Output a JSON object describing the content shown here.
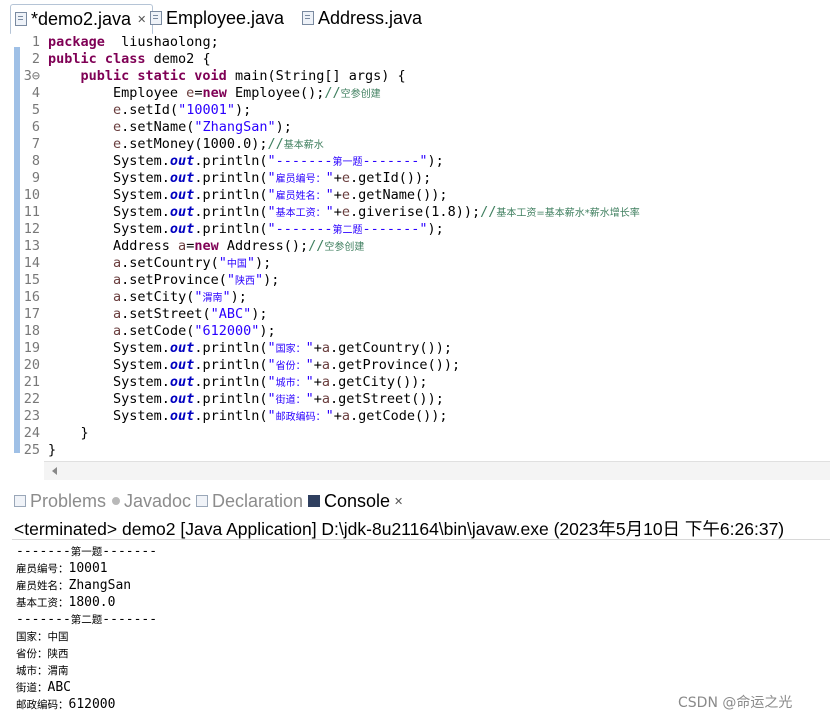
{
  "editor_tabs": [
    {
      "label": "*demo2.java",
      "active": true
    },
    {
      "label": "Employee.java",
      "active": false
    },
    {
      "label": "Address.java",
      "active": false
    }
  ],
  "code_lines": [
    {
      "n": "1",
      "tokens": [
        [
          "kw",
          "package"
        ],
        [
          "",
          "  liushaolong;"
        ]
      ]
    },
    {
      "n": "2",
      "tokens": [
        [
          "kw",
          "public class"
        ],
        [
          "",
          " demo2 {"
        ]
      ]
    },
    {
      "n": "3⊖",
      "tokens": [
        [
          "",
          "    "
        ],
        [
          "kw",
          "public static void"
        ],
        [
          "",
          " main(String[] args) {"
        ]
      ]
    },
    {
      "n": "4",
      "tokens": [
        [
          "",
          "        Employee "
        ],
        [
          "var",
          "e"
        ],
        [
          "",
          "="
        ],
        [
          "kw",
          "new"
        ],
        [
          "",
          " Employee();"
        ],
        [
          "cmt",
          "//"
        ],
        [
          "cmt cjk",
          "空参创建"
        ]
      ]
    },
    {
      "n": "5",
      "tokens": [
        [
          "",
          "        "
        ],
        [
          "var",
          "e"
        ],
        [
          "",
          ".setId("
        ],
        [
          "str",
          "\"10001\""
        ],
        [
          "",
          ");"
        ]
      ]
    },
    {
      "n": "6",
      "tokens": [
        [
          "",
          "        "
        ],
        [
          "var",
          "e"
        ],
        [
          "",
          ".setName("
        ],
        [
          "str",
          "\"ZhangSan\""
        ],
        [
          "",
          ");"
        ]
      ]
    },
    {
      "n": "7",
      "tokens": [
        [
          "",
          "        "
        ],
        [
          "var",
          "e"
        ],
        [
          "",
          ".setMoney(1000.0);"
        ],
        [
          "cmt",
          "//"
        ],
        [
          "cmt cjk",
          "基本薪水"
        ]
      ]
    },
    {
      "n": "8",
      "tokens": [
        [
          "",
          "        System."
        ],
        [
          "fld",
          "out"
        ],
        [
          "",
          ".println("
        ],
        [
          "str",
          "\"-------"
        ],
        [
          "str cjk",
          "第一题"
        ],
        [
          "str",
          "-------\""
        ],
        [
          "",
          ");"
        ]
      ]
    },
    {
      "n": "9",
      "tokens": [
        [
          "",
          "        System."
        ],
        [
          "fld",
          "out"
        ],
        [
          "",
          ".println("
        ],
        [
          "str",
          "\""
        ],
        [
          "str cjk",
          "雇员编号："
        ],
        [
          "str",
          "\""
        ],
        [
          "",
          "+"
        ],
        [
          "var",
          "e"
        ],
        [
          "",
          ".getId());"
        ]
      ]
    },
    {
      "n": "10",
      "tokens": [
        [
          "",
          "        System."
        ],
        [
          "fld",
          "out"
        ],
        [
          "",
          ".println("
        ],
        [
          "str",
          "\""
        ],
        [
          "str cjk",
          "雇员姓名："
        ],
        [
          "str",
          "\""
        ],
        [
          "",
          "+"
        ],
        [
          "var",
          "e"
        ],
        [
          "",
          ".getName());"
        ]
      ]
    },
    {
      "n": "11",
      "tokens": [
        [
          "",
          "        System."
        ],
        [
          "fld",
          "out"
        ],
        [
          "",
          ".println("
        ],
        [
          "str",
          "\""
        ],
        [
          "str cjk",
          "基本工资："
        ],
        [
          "str",
          "\""
        ],
        [
          "",
          "+"
        ],
        [
          "var",
          "e"
        ],
        [
          "",
          ".giverise(1.8));"
        ],
        [
          "cmt",
          "//"
        ],
        [
          "cmt cjk",
          "基本工资=基本薪水*薪水增长率"
        ]
      ]
    },
    {
      "n": "12",
      "tokens": [
        [
          "",
          "        System."
        ],
        [
          "fld",
          "out"
        ],
        [
          "",
          ".println("
        ],
        [
          "str",
          "\"-------"
        ],
        [
          "str cjk",
          "第二题"
        ],
        [
          "str",
          "-------\""
        ],
        [
          "",
          ");"
        ]
      ]
    },
    {
      "n": "13",
      "tokens": [
        [
          "",
          "        Address "
        ],
        [
          "var",
          "a"
        ],
        [
          "",
          "="
        ],
        [
          "kw",
          "new"
        ],
        [
          "",
          " Address();"
        ],
        [
          "cmt",
          "//"
        ],
        [
          "cmt cjk",
          "空参创建"
        ]
      ]
    },
    {
      "n": "14",
      "tokens": [
        [
          "",
          "        "
        ],
        [
          "var",
          "a"
        ],
        [
          "",
          ".setCountry("
        ],
        [
          "str",
          "\""
        ],
        [
          "str cjk",
          "中国"
        ],
        [
          "str",
          "\""
        ],
        [
          "",
          ");"
        ]
      ]
    },
    {
      "n": "15",
      "tokens": [
        [
          "",
          "        "
        ],
        [
          "var",
          "a"
        ],
        [
          "",
          ".setProvince("
        ],
        [
          "str",
          "\""
        ],
        [
          "str cjk",
          "陕西"
        ],
        [
          "str",
          "\""
        ],
        [
          "",
          ");"
        ]
      ]
    },
    {
      "n": "16",
      "tokens": [
        [
          "",
          "        "
        ],
        [
          "var",
          "a"
        ],
        [
          "",
          ".setCity("
        ],
        [
          "str",
          "\""
        ],
        [
          "str cjk",
          "渭南"
        ],
        [
          "str",
          "\""
        ],
        [
          "",
          ");"
        ]
      ]
    },
    {
      "n": "17",
      "tokens": [
        [
          "",
          "        "
        ],
        [
          "var",
          "a"
        ],
        [
          "",
          ".setStreet("
        ],
        [
          "str",
          "\"ABC\""
        ],
        [
          "",
          ");"
        ]
      ]
    },
    {
      "n": "18",
      "tokens": [
        [
          "",
          "        "
        ],
        [
          "var",
          "a"
        ],
        [
          "",
          ".setCode("
        ],
        [
          "str",
          "\"612000\""
        ],
        [
          "",
          ");"
        ]
      ]
    },
    {
      "n": "19",
      "tokens": [
        [
          "",
          "        System."
        ],
        [
          "fld",
          "out"
        ],
        [
          "",
          ".println("
        ],
        [
          "str",
          "\""
        ],
        [
          "str cjk",
          "国家："
        ],
        [
          "str",
          "\""
        ],
        [
          "",
          "+"
        ],
        [
          "var",
          "a"
        ],
        [
          "",
          ".getCountry());"
        ]
      ]
    },
    {
      "n": "20",
      "tokens": [
        [
          "",
          "        System."
        ],
        [
          "fld",
          "out"
        ],
        [
          "",
          ".println("
        ],
        [
          "str",
          "\""
        ],
        [
          "str cjk",
          "省份："
        ],
        [
          "str",
          "\""
        ],
        [
          "",
          "+"
        ],
        [
          "var",
          "a"
        ],
        [
          "",
          ".getProvince());"
        ]
      ]
    },
    {
      "n": "21",
      "tokens": [
        [
          "",
          "        System."
        ],
        [
          "fld",
          "out"
        ],
        [
          "",
          ".println("
        ],
        [
          "str",
          "\""
        ],
        [
          "str cjk",
          "城市："
        ],
        [
          "str",
          "\""
        ],
        [
          "",
          "+"
        ],
        [
          "var",
          "a"
        ],
        [
          "",
          ".getCity());"
        ]
      ]
    },
    {
      "n": "22",
      "tokens": [
        [
          "",
          "        System."
        ],
        [
          "fld",
          "out"
        ],
        [
          "",
          ".println("
        ],
        [
          "str",
          "\""
        ],
        [
          "str cjk",
          "街道："
        ],
        [
          "str",
          "\""
        ],
        [
          "",
          "+"
        ],
        [
          "var",
          "a"
        ],
        [
          "",
          ".getStreet());"
        ]
      ]
    },
    {
      "n": "23",
      "tokens": [
        [
          "",
          "        System."
        ],
        [
          "fld",
          "out"
        ],
        [
          "",
          ".println("
        ],
        [
          "str",
          "\""
        ],
        [
          "str cjk",
          "邮政编码："
        ],
        [
          "str",
          "\""
        ],
        [
          "",
          "+"
        ],
        [
          "var",
          "a"
        ],
        [
          "",
          ".getCode());"
        ]
      ]
    },
    {
      "n": "24",
      "tokens": [
        [
          "",
          "    }"
        ]
      ]
    },
    {
      "n": "25",
      "tokens": [
        [
          "",
          "}"
        ]
      ]
    }
  ],
  "panel_tabs": [
    {
      "label": "Problems",
      "icon": "problems-icon",
      "active": false
    },
    {
      "label": "Javadoc",
      "icon": "javadoc-icon",
      "active": false
    },
    {
      "label": "Declaration",
      "icon": "declaration-icon",
      "active": false
    },
    {
      "label": "Console",
      "icon": "console-icon",
      "active": true
    }
  ],
  "console": {
    "status": "<terminated> demo2 [Java Application] D:\\jdk-8u21164\\bin\\javaw.exe (2023年5月10日 下午6:26:37)",
    "lines": [
      [
        [
          "",
          "-------"
        ],
        [
          "cjk",
          "第一题"
        ],
        [
          "",
          "-------"
        ]
      ],
      [
        [
          "cjk",
          "雇员编号："
        ],
        [
          "",
          "10001"
        ]
      ],
      [
        [
          "cjk",
          "雇员姓名："
        ],
        [
          "",
          "ZhangSan"
        ]
      ],
      [
        [
          "cjk",
          "基本工资："
        ],
        [
          "",
          "1800.0"
        ]
      ],
      [
        [
          "",
          "-------"
        ],
        [
          "cjk",
          "第二题"
        ],
        [
          "",
          "-------"
        ]
      ],
      [
        [
          "cjk",
          "国家：中国"
        ]
      ],
      [
        [
          "cjk",
          "省份：陕西"
        ]
      ],
      [
        [
          "cjk",
          "城市：渭南"
        ]
      ],
      [
        [
          "cjk",
          "街道："
        ],
        [
          "",
          "ABC"
        ]
      ],
      [
        [
          "cjk",
          "邮政编码："
        ],
        [
          "",
          "612000"
        ]
      ]
    ]
  },
  "watermark": "CSDN @命运之光",
  "colors": {
    "keyword": "#7f0055",
    "string": "#2a00ff",
    "comment": "#3f7f5f",
    "field": "#0000c0"
  }
}
